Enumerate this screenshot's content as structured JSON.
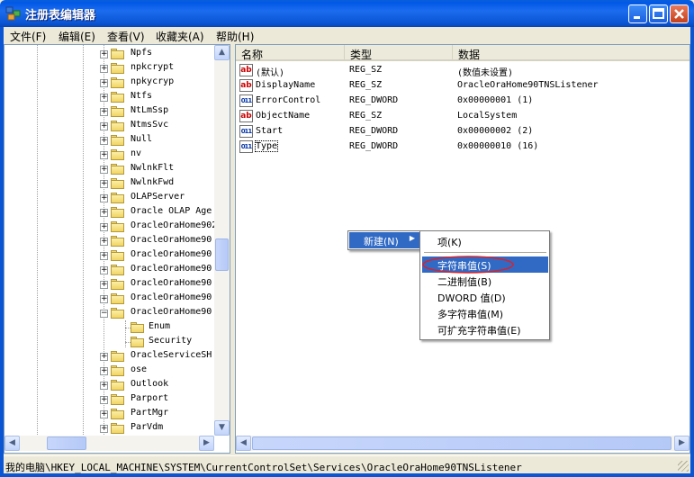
{
  "window": {
    "title": "注册表编辑器"
  },
  "menu": [
    {
      "label": "文件(F)"
    },
    {
      "label": "编辑(E)"
    },
    {
      "label": "查看(V)"
    },
    {
      "label": "收藏夹(A)"
    },
    {
      "label": "帮助(H)"
    }
  ],
  "tree": [
    {
      "label": "Npfs",
      "expander": "+"
    },
    {
      "label": "npkcrypt",
      "expander": "+"
    },
    {
      "label": "npkycryp",
      "expander": "+"
    },
    {
      "label": "Ntfs",
      "expander": "+"
    },
    {
      "label": "NtLmSsp",
      "expander": "+"
    },
    {
      "label": "NtmsSvc",
      "expander": "+"
    },
    {
      "label": "Null",
      "expander": "+"
    },
    {
      "label": "nv",
      "expander": "+"
    },
    {
      "label": "NwlnkFlt",
      "expander": "+"
    },
    {
      "label": "NwlnkFwd",
      "expander": "+"
    },
    {
      "label": "OLAPServer",
      "expander": "+"
    },
    {
      "label": "Oracle OLAP Age",
      "expander": "+"
    },
    {
      "label": "OracleOraHome902",
      "expander": "+"
    },
    {
      "label": "OracleOraHome90",
      "expander": "+"
    },
    {
      "label": "OracleOraHome90",
      "expander": "+"
    },
    {
      "label": "OracleOraHome90",
      "expander": "+"
    },
    {
      "label": "OracleOraHome90",
      "expander": "+"
    },
    {
      "label": "OracleOraHome90",
      "expander": "+"
    },
    {
      "label": "OracleOraHome90",
      "expander": "-"
    },
    {
      "label": "Enum",
      "expander": ""
    },
    {
      "label": "Security",
      "expander": ""
    },
    {
      "label": "OracleServiceSH",
      "expander": "+"
    },
    {
      "label": "ose",
      "expander": "+"
    },
    {
      "label": "Outlook",
      "expander": "+"
    },
    {
      "label": "Parport",
      "expander": "+"
    },
    {
      "label": "PartMgr",
      "expander": "+"
    },
    {
      "label": "ParVdm",
      "expander": "+"
    }
  ],
  "list": {
    "headers": {
      "name": "名称",
      "type": "类型",
      "data": "数据"
    },
    "rows": [
      {
        "icon": "ab",
        "name": "(默认)",
        "type": "REG_SZ",
        "data": "(数值未设置)"
      },
      {
        "icon": "ab",
        "name": "DisplayName",
        "type": "REG_SZ",
        "data": "OracleOraHome90TNSListener"
      },
      {
        "icon": "011",
        "name": "ErrorControl",
        "type": "REG_DWORD",
        "data": "0x00000001 (1)"
      },
      {
        "icon": "ab",
        "name": "ObjectName",
        "type": "REG_SZ",
        "data": "LocalSystem"
      },
      {
        "icon": "011",
        "name": "Start",
        "type": "REG_DWORD",
        "data": "0x00000002 (2)"
      },
      {
        "icon": "011",
        "name": "Type",
        "type": "REG_DWORD",
        "data": "0x00000010 (16)"
      }
    ]
  },
  "context_menu": {
    "parent": "新建(N)",
    "items": [
      {
        "label": "项(K)"
      },
      {
        "label": "字符串值(S)"
      },
      {
        "label": "二进制值(B)"
      },
      {
        "label": "DWORD 值(D)"
      },
      {
        "label": "多字符串值(M)"
      },
      {
        "label": "可扩充字符串值(E)"
      }
    ]
  },
  "status": {
    "path": "我的电脑\\HKEY_LOCAL_MACHINE\\SYSTEM\\CurrentControlSet\\Services\\OracleOraHome90TNSListener"
  },
  "colors": {
    "titlebar": "#0a55d4",
    "highlight": "#316ac5",
    "annotation_circle": "#d8232a"
  }
}
